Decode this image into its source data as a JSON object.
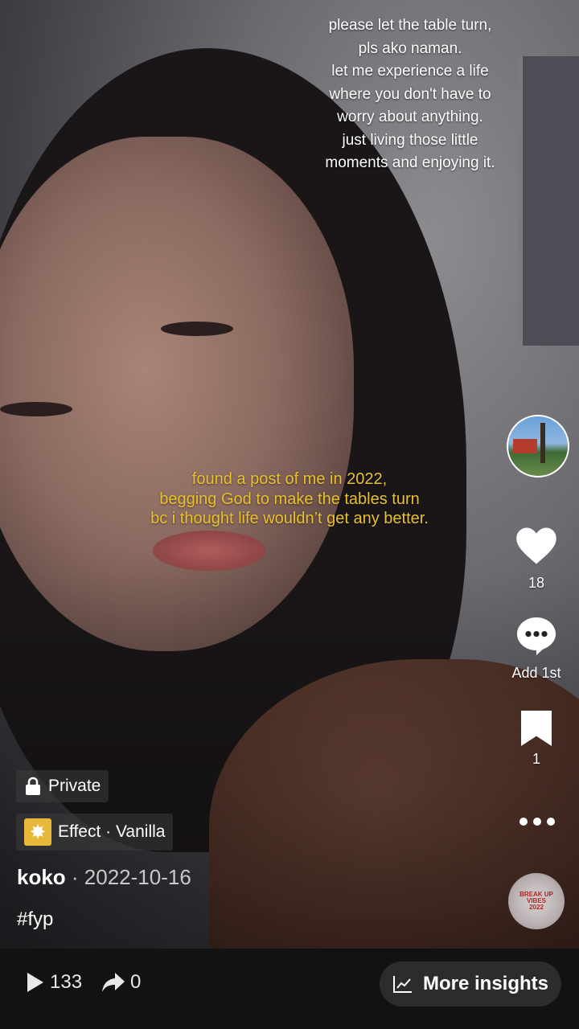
{
  "video": {
    "top_caption_lines": [
      "please let the table turn,",
      "pls ako naman.",
      "let me experience a life",
      "where you don't have to",
      "worry about anything.",
      "just living those little",
      "moments and enjoying it."
    ],
    "mid_caption_lines": [
      "found a post of me in 2022,",
      "begging God to make the tables turn",
      "bc i thought life wouldn’t get any better."
    ],
    "mid_caption_color": "#e9c12e"
  },
  "actions": {
    "likes": "18",
    "comments_label": "Add 1st",
    "bookmarks": "1",
    "sound_disc_text": [
      "BREAK UP",
      "VIBES",
      "2022"
    ]
  },
  "info": {
    "privacy_label": "Private",
    "effect_label": "Effect · Vanilla",
    "author": "koko",
    "date": " · 2022-10-16",
    "hashtag": "#fyp"
  },
  "bottom_bar": {
    "views": "133",
    "shares": "0",
    "insights_label": "More insights"
  },
  "icons": [
    "lock-icon",
    "effect-icon",
    "heart-icon",
    "comment-icon",
    "bookmark-icon",
    "more-icon",
    "play-icon",
    "share-icon",
    "chart-icon"
  ]
}
